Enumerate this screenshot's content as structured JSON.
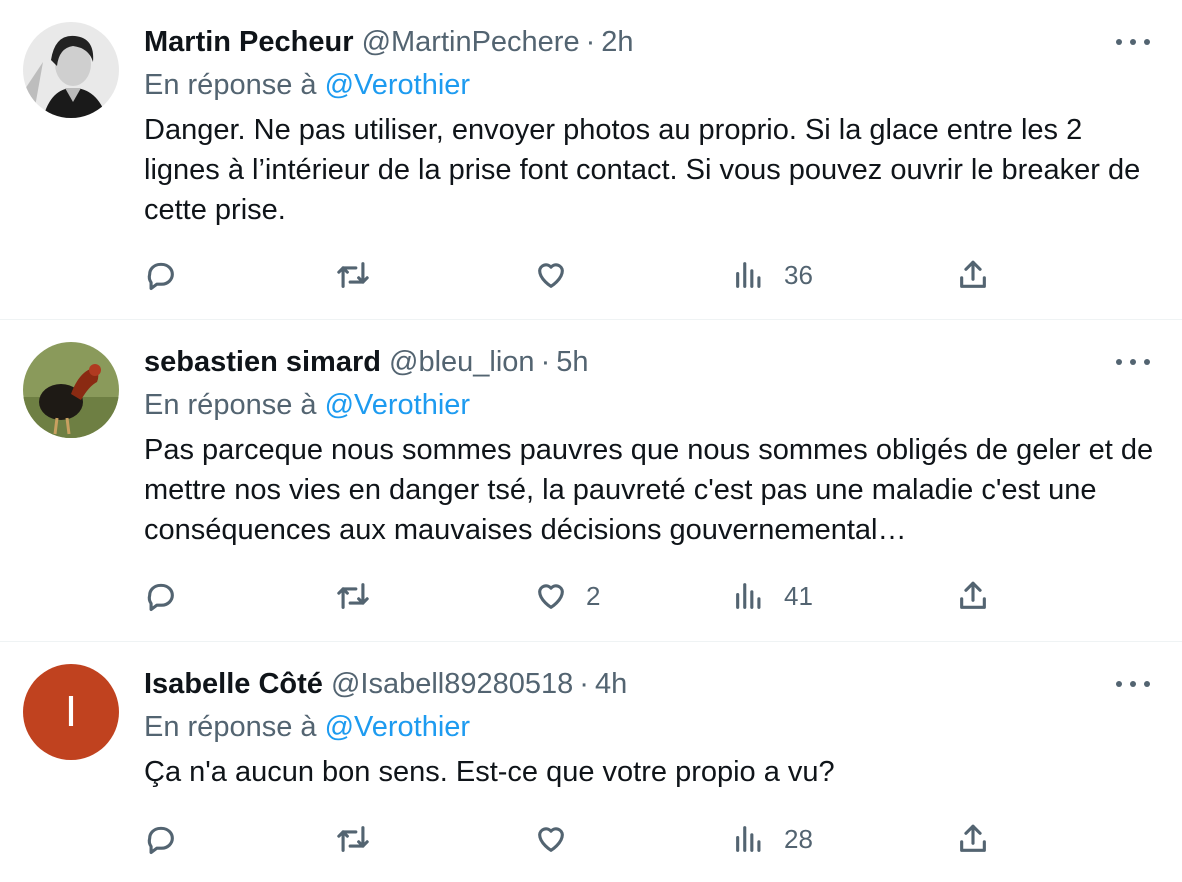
{
  "tweets": [
    {
      "name": "Martin Pecheur",
      "handle": "@MartinPechere",
      "time": "2h",
      "reply_prefix": "En réponse à",
      "reply_to": "@Verothier",
      "text": "Danger. Ne pas utiliser, envoyer photos au proprio. Si la glace entre les 2 lignes à l’intérieur de la prise font contact. Si vous pouvez ouvrir le breaker de cette prise.",
      "likes": "",
      "views": "36"
    },
    {
      "name": "sebastien simard",
      "handle": "@bleu_lion",
      "time": "5h",
      "reply_prefix": "En réponse à",
      "reply_to": "@Verothier",
      "text": "Pas parceque nous sommes pauvres que nous sommes obligés de geler et de mettre nos vies en danger tsé, la pauvreté c'est pas une maladie c'est une conséquences aux mauvaises décisions gouvernemental…",
      "likes": "2",
      "views": "41"
    },
    {
      "name": "Isabelle Côté",
      "handle": "@Isabell89280518",
      "time": "4h",
      "reply_prefix": "En réponse à",
      "reply_to": "@Verothier",
      "text": "Ça n'a aucun bon sens. Est-ce que votre propio a vu?",
      "avatar_letter": "I",
      "likes": "",
      "views": "28"
    }
  ],
  "colors": {
    "text": "#0f1419",
    "secondary": "#536471",
    "link": "#1d9bf0",
    "divider": "#eff3f4",
    "letter_avatar_bg": "#c0421f"
  },
  "icons": [
    "reply-icon",
    "retweet-icon",
    "like-icon",
    "views-icon",
    "share-icon",
    "more-icon"
  ]
}
